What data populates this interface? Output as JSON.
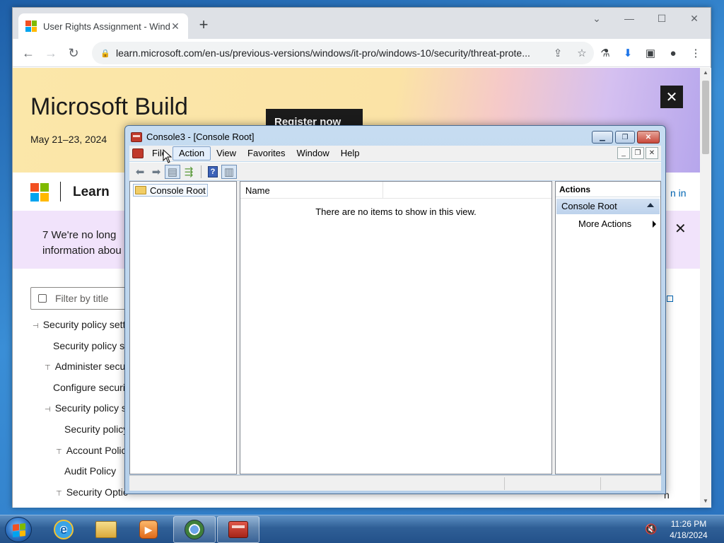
{
  "browser": {
    "tab_title": "User Rights Assignment - Windo",
    "url": "learn.microsoft.com/en-us/previous-versions/windows/it-pro/windows-10/security/threat-prote..."
  },
  "banner": {
    "title": "Microsoft Build",
    "date": "May 21–23, 2024",
    "register_label": "Register now",
    "close_label": "✕"
  },
  "learn": {
    "brand": "Learn",
    "signin_fragment": "n in"
  },
  "notice": {
    "text_line1": "7  We're no long",
    "text_line2": "information abou",
    "close_label": "✕"
  },
  "filter": {
    "placeholder": "Filter by title"
  },
  "toc": {
    "items": [
      "Security policy sett",
      "Security policy s",
      "Administer secur",
      "Configure securi",
      "Security policy s",
      "Security policy",
      "Account Polic",
      "Audit Policy",
      "Security Optic"
    ]
  },
  "page_fragments": {
    "right_text": "n"
  },
  "mmc": {
    "title": "Console3 - [Console Root]",
    "menu": [
      "File",
      "Action",
      "View",
      "Favorites",
      "Window",
      "Help"
    ],
    "tree_root": "Console Root",
    "list_column": "Name",
    "empty_message": "There are no items to show in this view.",
    "actions_header": "Actions",
    "actions_section": "Console Root",
    "more_actions": "More Actions"
  },
  "taskbar": {
    "time": "11:26 PM",
    "date": "4/18/2024"
  },
  "colors": {
    "ms_red": "#f25022",
    "ms_green": "#7fba00",
    "ms_blue": "#00a4ef",
    "ms_yellow": "#ffb900"
  }
}
